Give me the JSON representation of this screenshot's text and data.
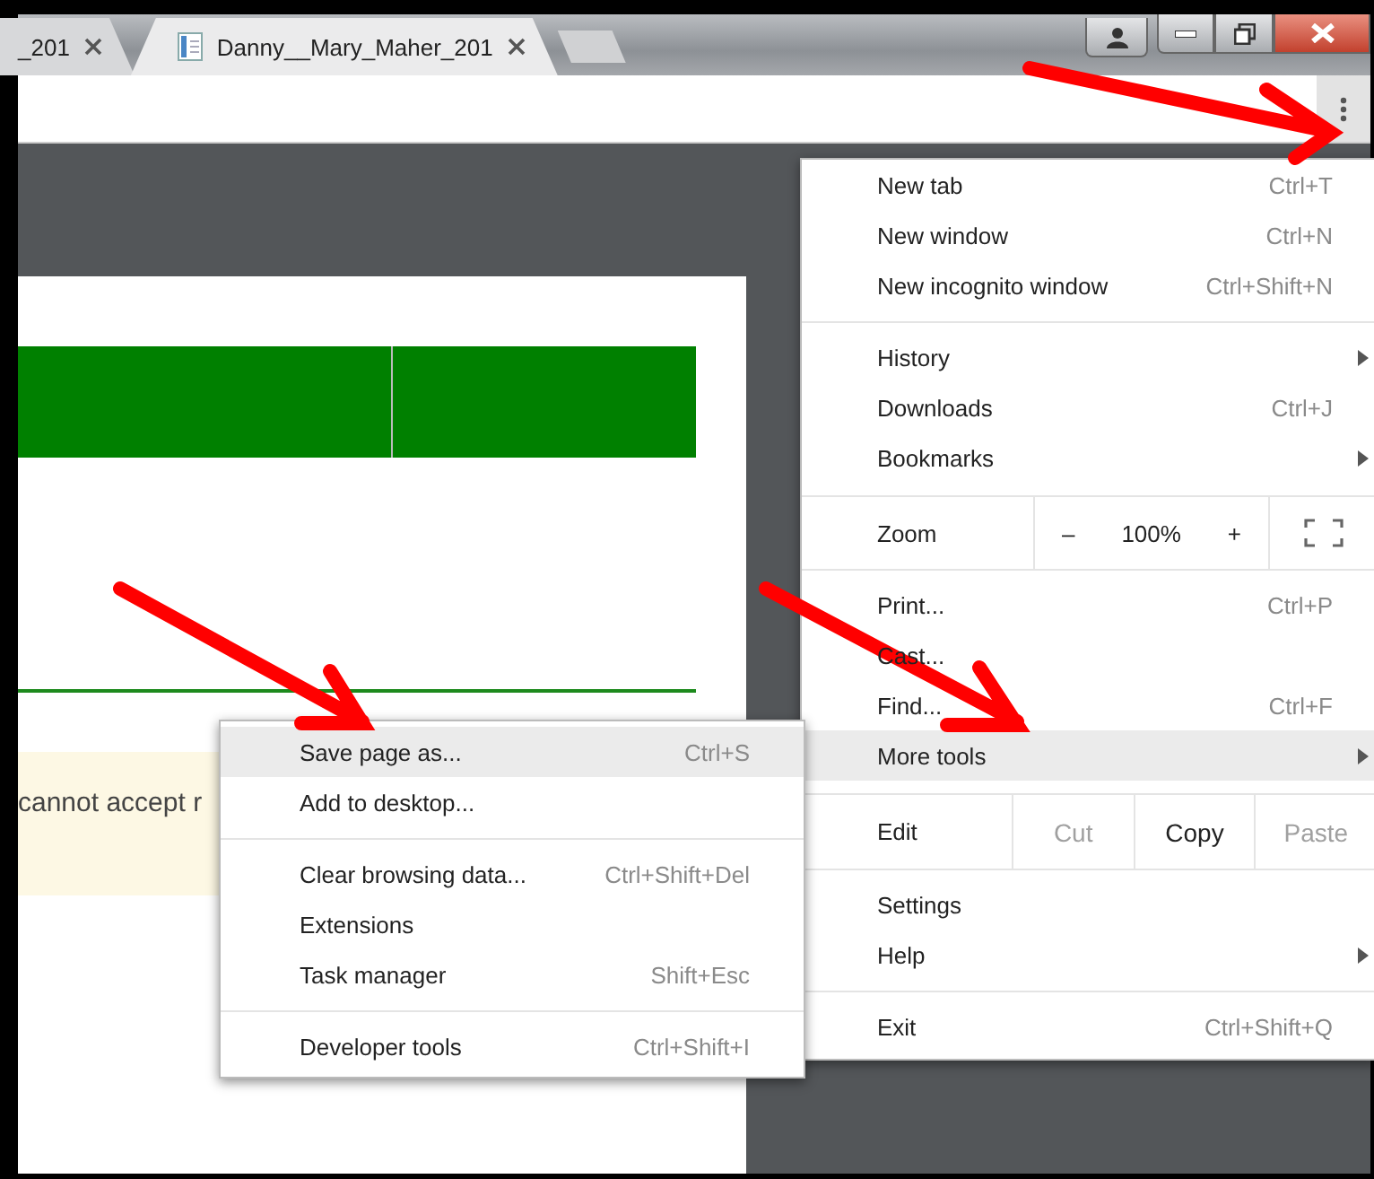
{
  "tabs": [
    {
      "title": "_201",
      "selected": false
    },
    {
      "title": "Danny__Mary_Maher_201",
      "selected": true
    }
  ],
  "page": {
    "notice": "cannot accept r"
  },
  "menu": {
    "items": [
      {
        "kind": "item",
        "label": "New tab",
        "shortcut": "Ctrl+T",
        "submenu": false,
        "selected": false
      },
      {
        "kind": "item",
        "label": "New window",
        "shortcut": "Ctrl+N",
        "submenu": false,
        "selected": false
      },
      {
        "kind": "item",
        "label": "New incognito window",
        "shortcut": "Ctrl+Shift+N",
        "submenu": false,
        "selected": false
      },
      {
        "kind": "separator"
      },
      {
        "kind": "item",
        "label": "History",
        "submenu": true,
        "selected": false
      },
      {
        "kind": "item",
        "label": "Downloads",
        "shortcut": "Ctrl+J",
        "submenu": false,
        "selected": false
      },
      {
        "kind": "item",
        "label": "Bookmarks",
        "submenu": true,
        "selected": false
      },
      {
        "kind": "separator"
      },
      {
        "kind": "zoom",
        "label": "Zoom",
        "minus": "–",
        "value": "100%",
        "plus": "+"
      },
      {
        "kind": "item",
        "label": "Print...",
        "shortcut": "Ctrl+P",
        "submenu": false,
        "selected": false
      },
      {
        "kind": "item",
        "label": "Cast...",
        "submenu": false,
        "selected": false
      },
      {
        "kind": "item",
        "label": "Find...",
        "shortcut": "Ctrl+F",
        "submenu": false,
        "selected": false
      },
      {
        "kind": "item",
        "label": "More tools",
        "submenu": true,
        "selected": true
      },
      {
        "kind": "edit",
        "label": "Edit",
        "buttons": [
          {
            "label": "Cut",
            "disabled": true
          },
          {
            "label": "Copy",
            "disabled": false
          },
          {
            "label": "Paste",
            "disabled": true
          }
        ]
      },
      {
        "kind": "item",
        "label": "Settings",
        "submenu": false,
        "selected": false
      },
      {
        "kind": "item",
        "label": "Help",
        "submenu": true,
        "selected": false
      },
      {
        "kind": "separator"
      },
      {
        "kind": "item",
        "label": "Exit",
        "shortcut": "Ctrl+Shift+Q",
        "submenu": false,
        "selected": false
      }
    ]
  },
  "submenu": {
    "items": [
      {
        "kind": "item",
        "label": "Save page as...",
        "shortcut": "Ctrl+S",
        "selected": true
      },
      {
        "kind": "item",
        "label": "Add to desktop...",
        "selected": false
      },
      {
        "kind": "separator"
      },
      {
        "kind": "item",
        "label": "Clear browsing data...",
        "shortcut": "Ctrl+Shift+Del",
        "selected": false
      },
      {
        "kind": "item",
        "label": "Extensions",
        "selected": false
      },
      {
        "kind": "item",
        "label": "Task manager",
        "shortcut": "Shift+Esc",
        "selected": false
      },
      {
        "kind": "separator"
      },
      {
        "kind": "item",
        "label": "Developer tools",
        "shortcut": "Ctrl+Shift+I",
        "selected": false
      }
    ]
  }
}
